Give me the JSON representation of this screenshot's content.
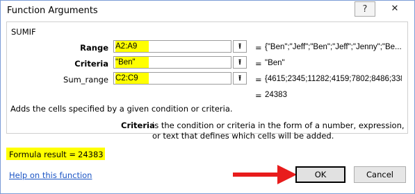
{
  "window": {
    "title": "Function Arguments",
    "help_button": "?",
    "close_button": "✕"
  },
  "group": {
    "title": "SUMIF"
  },
  "arguments": [
    {
      "label": "Range",
      "value": "A2:A9",
      "result": "{\"Ben\";\"Jeff\";\"Ben\";\"Jeff\";\"Jenny\";\"Be..."
    },
    {
      "label": "Criteria",
      "value": "\"Ben\"",
      "result": "\"Ben\""
    },
    {
      "label": "Sum_range",
      "value": "C2:C9",
      "result": "{4615;2345;11282;4159;7802;8486;3384"
    }
  ],
  "equals": "=",
  "function_result": "24383",
  "description": "Adds the cells specified by a given condition or criteria.",
  "criteria_help": {
    "label": "Criteria",
    "text": "is the condition or criteria in the form of a number, expression, or text that defines which cells will be added."
  },
  "formula_result": {
    "label": "Formula result =",
    "value": "24383"
  },
  "help_link": "Help on this function",
  "buttons": {
    "ok": "OK",
    "cancel": "Cancel"
  },
  "colors": {
    "highlight": "#ffff00",
    "arrow": "#e81c1c",
    "link": "#1a54c4"
  },
  "icons": {
    "collapse": "collapse-dialog-icon"
  }
}
